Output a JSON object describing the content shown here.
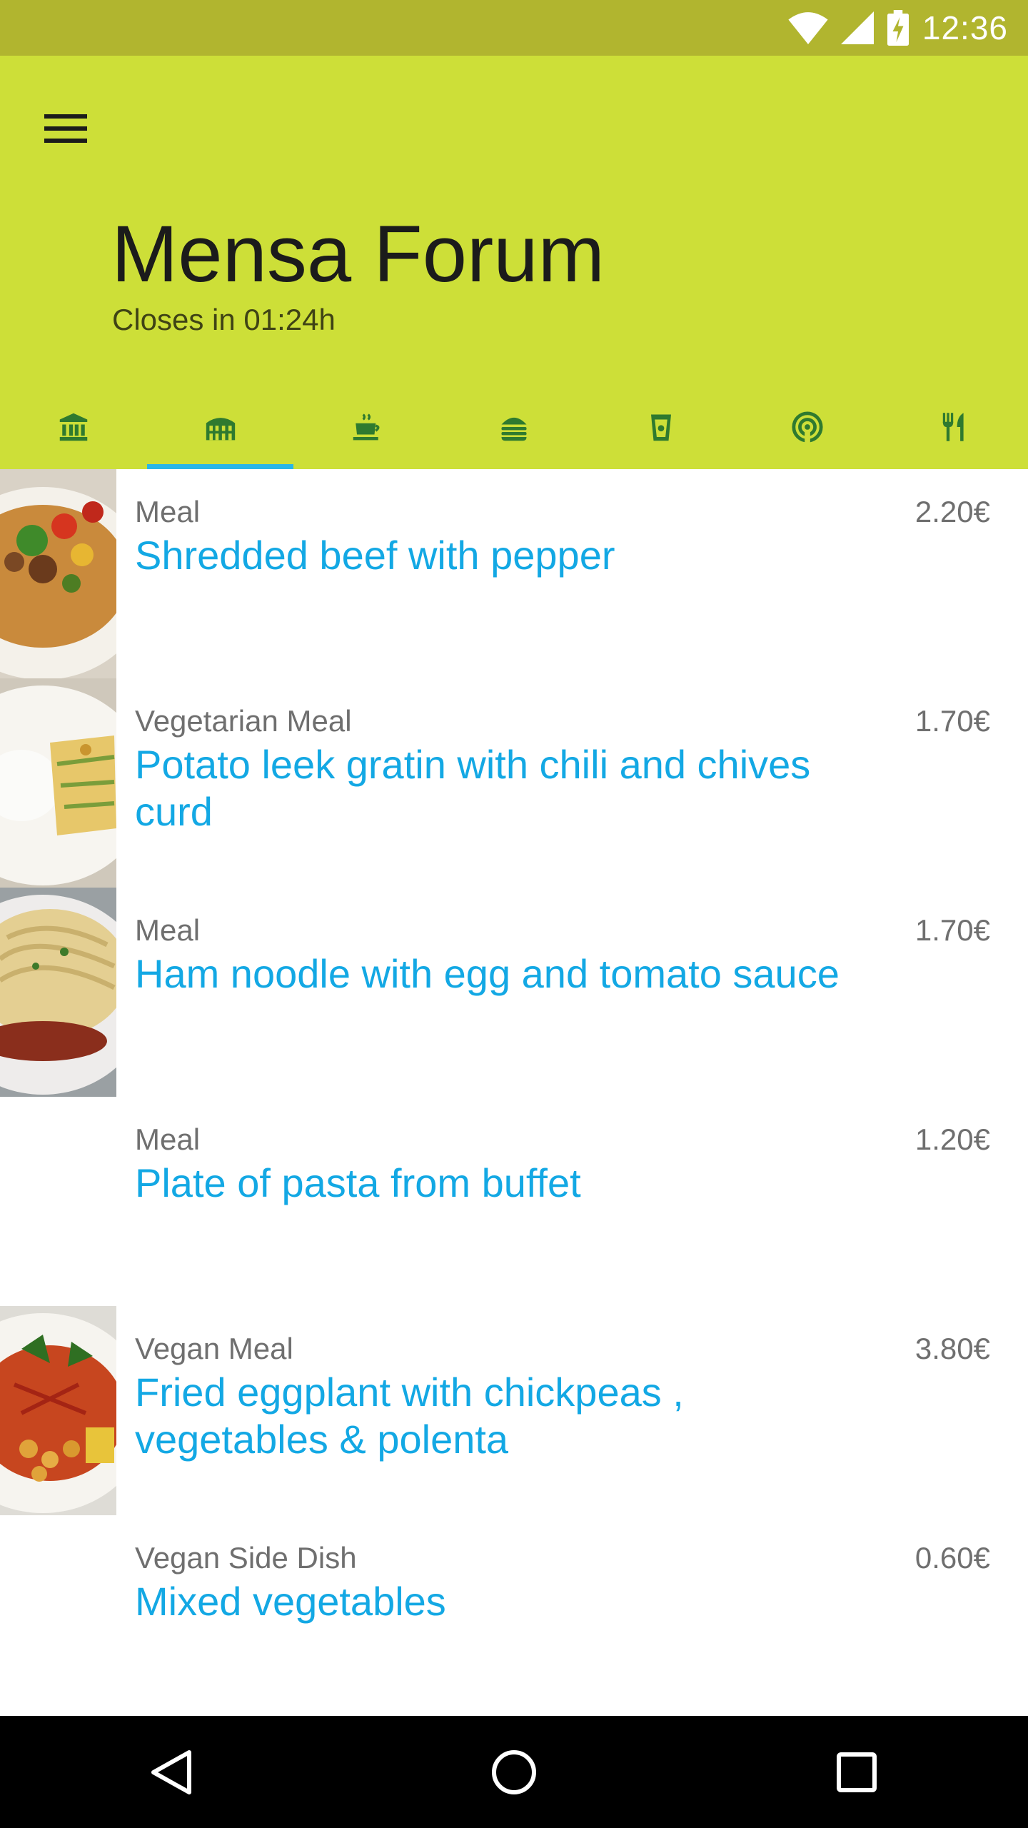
{
  "status_bar": {
    "time": "12:36"
  },
  "header": {
    "title": "Mensa Forum",
    "subtitle": "Closes in 01:24h",
    "accent_color": "#cddf38",
    "status_color": "#b1b52f",
    "indicator_color": "#29b6e7"
  },
  "tabs": [
    {
      "icon": "bank-icon",
      "active": false
    },
    {
      "icon": "colosseum-icon",
      "active": true
    },
    {
      "icon": "coffee-cup-icon",
      "active": false
    },
    {
      "icon": "burger-icon",
      "active": false
    },
    {
      "icon": "drink-cup-icon",
      "active": false
    },
    {
      "icon": "broadcast-icon",
      "active": false
    },
    {
      "icon": "cutlery-icon",
      "active": false
    }
  ],
  "meals": [
    {
      "category": "Meal",
      "name": "Shredded beef with pepper",
      "price": "2.20€",
      "image": "beef-pepper-photo"
    },
    {
      "category": "Vegetarian Meal",
      "name": "Potato leek gratin with chili and chives curd",
      "price": "1.70€",
      "image": "gratin-photo"
    },
    {
      "category": "Meal",
      "name": "Ham noodle with egg and tomato sauce",
      "price": "1.70€",
      "image": "noodle-photo"
    },
    {
      "category": "Meal",
      "name": "Plate of pasta from buffet",
      "price": "1.20€",
      "image": ""
    },
    {
      "category": "Vegan Meal",
      "name": "Fried eggplant with chickpeas , vegetables & polenta",
      "price": "3.80€",
      "image": "eggplant-photo"
    },
    {
      "category": "Vegan Side Dish",
      "name": "Mixed vegetables",
      "price": "0.60€",
      "image": ""
    }
  ],
  "nav": {
    "back": "back-icon",
    "home": "home-icon",
    "recents": "recents-icon"
  }
}
